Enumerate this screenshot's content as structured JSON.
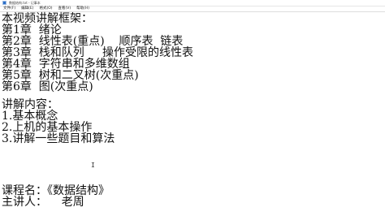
{
  "window": {
    "title": "数据结构.txt - 记事本"
  },
  "menu": {
    "items": [
      "文件(F)",
      "编辑(E)",
      "格式(O)",
      "查看(V)",
      "帮助(H)"
    ]
  },
  "document": {
    "lines": [
      "本视频讲解框架：",
      "第1章  绪论",
      "第2章  线性表(重点)    顺序表  链表",
      "第3章  栈和队列     操作受限的线性表",
      "第4章  字符串和多维数组",
      "第5章  树和二叉树(次重点)",
      "第6章  图(次重点)",
      "讲解内容：",
      "1.基本概念",
      "2.上机的基本操作",
      "3.讲解一些题目和算法",
      "课程名：《数据结构》",
      "主讲人：    老周"
    ]
  },
  "editor": {
    "caret_glyph": "I"
  }
}
